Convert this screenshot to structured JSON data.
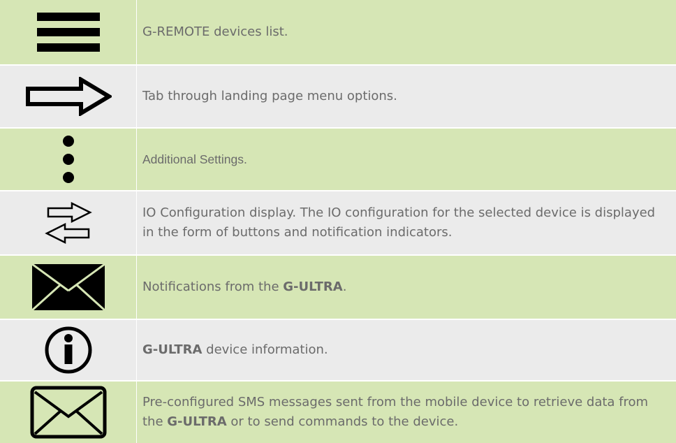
{
  "colors": {
    "row_green": "#d6e6b5",
    "row_grey": "#ebebeb",
    "text": "#6b6b6b",
    "icon": "#000000"
  },
  "rows": [
    {
      "icon": "hamburger-menu-icon",
      "text": "G-REMOTE devices list."
    },
    {
      "icon": "right-arrow-icon",
      "text": "Tab through landing page menu options."
    },
    {
      "icon": "vertical-dots-icon",
      "text": "Additional Settings."
    },
    {
      "icon": "swap-arrows-icon",
      "text": "IO Configuration display. The IO configuration for the selected device is displayed in the form of buttons and notification indicators."
    },
    {
      "icon": "filled-envelope-icon",
      "text_before": "Notifications from the ",
      "text_bold": "G-ULTRA",
      "text_after": "."
    },
    {
      "icon": "info-circle-icon",
      "text_bold": "G-ULTRA",
      "text_after": " device information."
    },
    {
      "icon": "outline-envelope-icon",
      "text_before": "Pre-configured SMS messages sent from the mobile device to retrieve data from the ",
      "text_bold": "G-ULTRA",
      "text_after": " or to send commands to the device."
    }
  ]
}
